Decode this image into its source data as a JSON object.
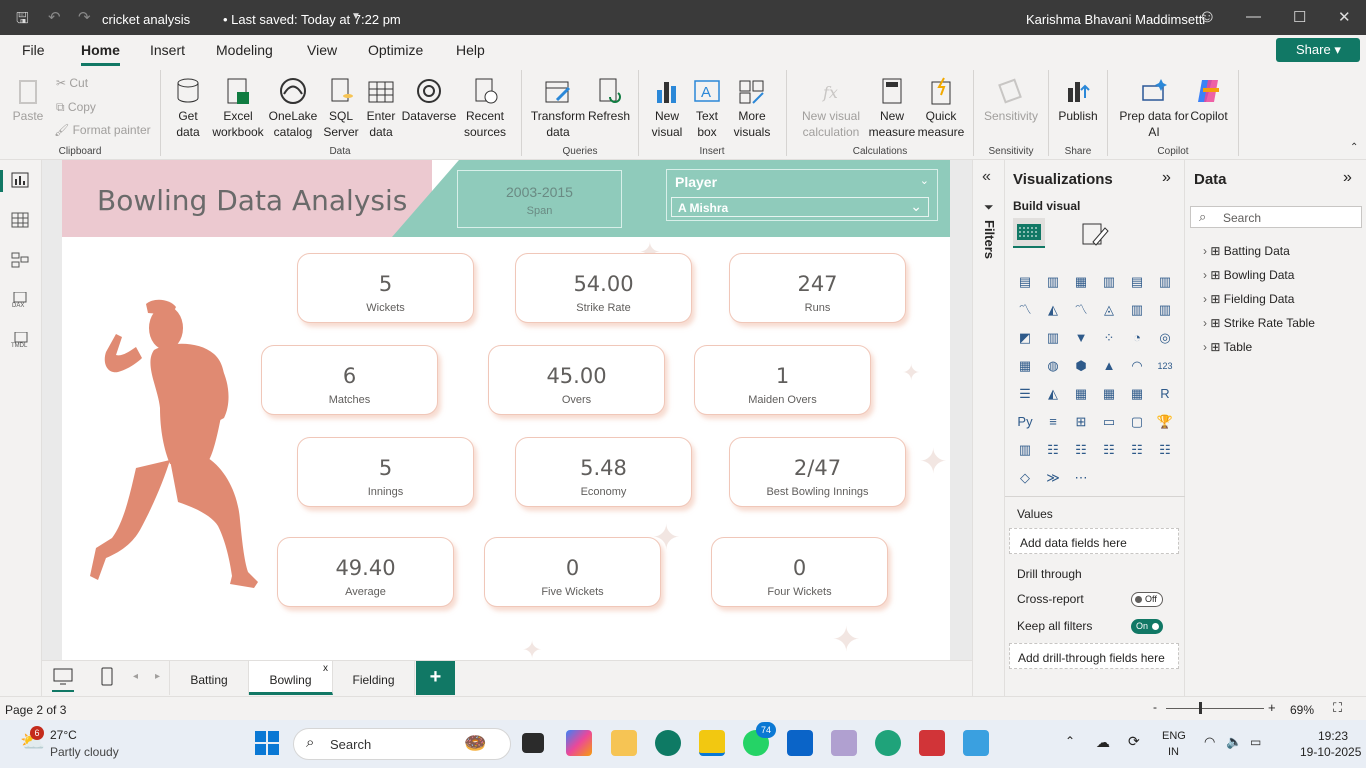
{
  "titlebar": {
    "doc_title": "cricket analysis",
    "saved": "• Last saved: Today at 7:22 pm",
    "user": "Karishma Bhavani Maddimsetti"
  },
  "menu": {
    "items": [
      "File",
      "Home",
      "Insert",
      "Modeling",
      "View",
      "Optimize",
      "Help"
    ],
    "active": "Home",
    "share": "Share"
  },
  "ribbon": {
    "clipboard": {
      "paste": "Paste",
      "cut": "Cut",
      "copy": "Copy",
      "format_painter": "Format painter",
      "group": "Clipboard"
    },
    "data": {
      "get_data": "Get data",
      "excel": "Excel workbook",
      "onelake": "OneLake catalog",
      "sql": "SQL Server",
      "enter": "Enter data",
      "dataverse": "Dataverse",
      "recent": "Recent sources",
      "group": "Data"
    },
    "queries": {
      "transform": "Transform data",
      "refresh": "Refresh",
      "group": "Queries"
    },
    "insert": {
      "new_visual": "New visual",
      "text_box": "Text box",
      "more_visuals": "More visuals",
      "group": "Insert"
    },
    "calculations": {
      "new_visual_calc": "New visual calculation",
      "new_measure": "New measure",
      "quick_measure": "Quick measure",
      "group": "Calculations"
    },
    "sensitivity": {
      "label": "Sensitivity",
      "group": "Sensitivity"
    },
    "share": {
      "publish": "Publish",
      "group": "Share"
    },
    "copilot": {
      "prep": "Prep data for AI",
      "copilot": "Copilot",
      "group": "Copilot"
    }
  },
  "report": {
    "title": "Bowling Data Analysis",
    "span_value": "2003-2015",
    "span_label": "Span",
    "slicer_title": "Player",
    "slicer_value": "A Mishra",
    "cards": [
      {
        "value": "5",
        "label": "Wickets"
      },
      {
        "value": "54.00",
        "label": "Strike Rate"
      },
      {
        "value": "247",
        "label": "Runs"
      },
      {
        "value": "6",
        "label": "Matches"
      },
      {
        "value": "45.00",
        "label": "Overs"
      },
      {
        "value": "1",
        "label": "Maiden Overs"
      },
      {
        "value": "5",
        "label": "Innings"
      },
      {
        "value": "5.48",
        "label": "Economy"
      },
      {
        "value": "2/47",
        "label": "Best Bowling Innings"
      },
      {
        "value": "49.40",
        "label": "Average"
      },
      {
        "value": "0",
        "label": "Five Wickets"
      },
      {
        "value": "0",
        "label": "Four Wickets"
      }
    ]
  },
  "filters": {
    "label": "Filters"
  },
  "visualizations": {
    "title": "Visualizations",
    "build": "Build visual",
    "values_label": "Values",
    "values_placeholder": "Add data fields here",
    "drill_label": "Drill through",
    "cross_report": "Cross-report",
    "cross_report_state": "Off",
    "keep_filters": "Keep all filters",
    "keep_filters_state": "On",
    "drill_placeholder": "Add drill-through fields here"
  },
  "data_pane": {
    "title": "Data",
    "search_placeholder": "Search",
    "tables": [
      "Batting Data",
      "Bowling Data",
      "Fielding Data",
      "Strike Rate Table",
      "Table"
    ]
  },
  "pages": {
    "tabs": [
      "Batting",
      "Bowling",
      "Fielding"
    ],
    "active": "Bowling",
    "add": "+"
  },
  "status": {
    "page": "Page 2 of 3",
    "zoom": "69%",
    "zoom_level": 0.69
  },
  "taskbar": {
    "weather_badge": "6",
    "temp": "27°C",
    "weather": "Partly cloudy",
    "search": "Search",
    "whatsapp_badge": "74",
    "lang1": "ENG",
    "lang2": "IN",
    "time": "19:23",
    "date": "19-10-2025"
  },
  "colors": {
    "accent": "#117865",
    "header_pink": "#ecc9d0",
    "header_teal": "#8fcbbb",
    "card_border": "#f0c7b9",
    "bowler": "#e08a72"
  }
}
